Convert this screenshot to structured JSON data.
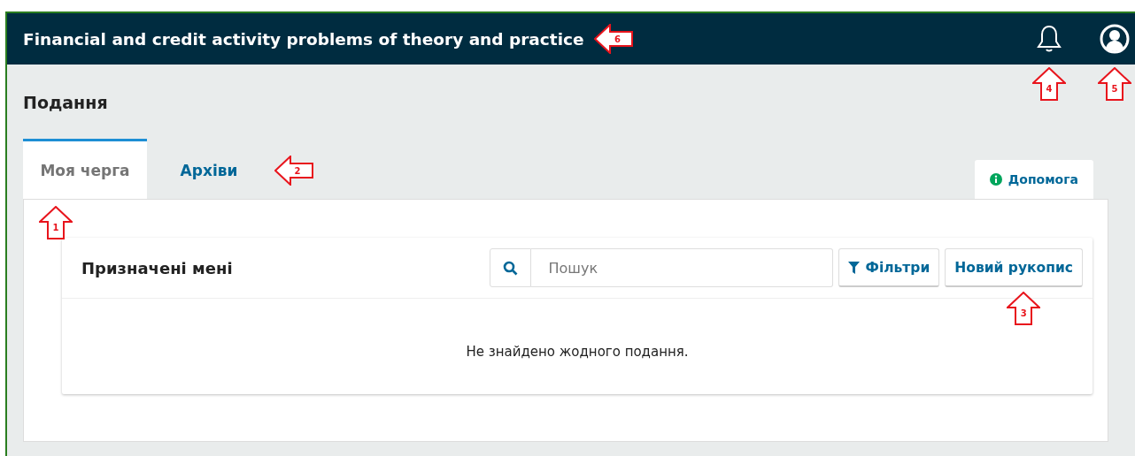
{
  "header": {
    "title": "Financial and credit activity problems of theory and practice",
    "title_callout": {
      "number": "6",
      "kind": "left"
    },
    "icons": [
      {
        "kind": "bell",
        "callout": {
          "number": "4",
          "kind": "up"
        }
      },
      {
        "kind": "user",
        "callout": {
          "number": "5",
          "kind": "up"
        }
      }
    ]
  },
  "page_title": "Подання",
  "tabs": [
    {
      "label": "Моя черга",
      "selected": true,
      "callout": {
        "number": "1",
        "kind": "up"
      }
    },
    {
      "label": "Архіви",
      "selected": false,
      "callout": {
        "number": "2",
        "kind": "left"
      }
    }
  ],
  "help_tab": {
    "label": "Допомога"
  },
  "card": {
    "title": "Призначені мені",
    "search": {
      "placeholder": "Пошук"
    },
    "buttons": [
      {
        "kind": "filter",
        "label": "Фільтри"
      },
      {
        "kind": "plain",
        "label": "Новий рукопис",
        "callout": {
          "number": "3",
          "kind": "up"
        }
      }
    ],
    "empty_message": "Не знайдено жодного подання."
  }
}
